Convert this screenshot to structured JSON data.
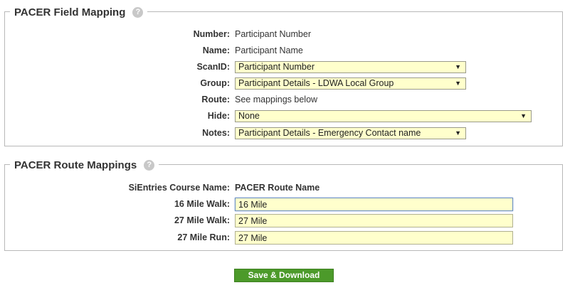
{
  "field_mapping": {
    "title": "PACER Field Mapping",
    "help_icon": "question-circle-icon",
    "rows": [
      {
        "label": "Number:",
        "value": "Participant Number"
      },
      {
        "label": "Name:",
        "value": "Participant Name"
      },
      {
        "label": "ScanID:",
        "selected": "Participant Number"
      },
      {
        "label": "Group:",
        "selected": "Participant Details - LDWA Local Group"
      },
      {
        "label": "Route:",
        "value": "See mappings below"
      },
      {
        "label": "Hide:",
        "selected": "None"
      },
      {
        "label": "Notes:",
        "selected": "Participant Details - Emergency Contact name"
      }
    ]
  },
  "route_mapping": {
    "title": "PACER Route Mappings",
    "help_icon": "question-circle-icon",
    "header": {
      "label": "SiEntries Course Name:",
      "value": "PACER Route Name"
    },
    "rows": [
      {
        "label": "16 Mile Walk:",
        "value": "16 Mile"
      },
      {
        "label": "27 Mile Walk:",
        "value": "27 Mile"
      },
      {
        "label": "27 Mile Run:",
        "value": "27 Mile"
      }
    ]
  },
  "save_button": {
    "label": "Save & Download"
  },
  "colors": {
    "input_bg": "#ffffcc",
    "button_bg": "#4c9a2a",
    "border": "#b8b8b8"
  }
}
